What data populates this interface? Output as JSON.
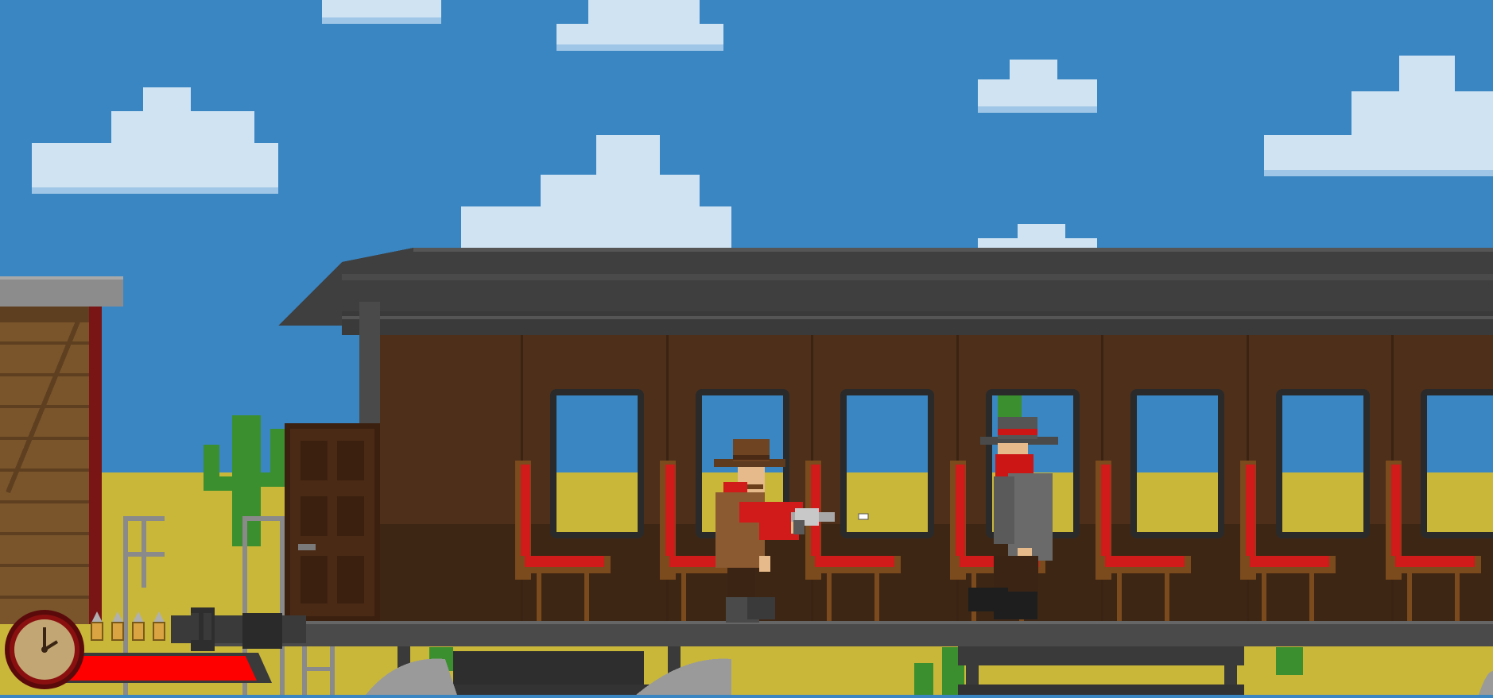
{
  "colors": {
    "sky": "#3a86c2",
    "cloud": "#cfe3f2",
    "cloud_shade": "#9fc6e6",
    "desert": "#c9b73a",
    "cactus": "#3b8f2e",
    "train_roof": "#3f3f3f",
    "train_body": "#4d2f1a",
    "train_body_lower": "#3e2614",
    "seat_red": "#d11a1a",
    "seat_wood": "#7b4a1d",
    "health_red": "#ff0000",
    "bandana_red": "#cc1515"
  },
  "icons": {
    "clock": "clock-icon",
    "bullet": "bullet-icon",
    "cactus": "cactus-icon"
  },
  "hud": {
    "ammo_remaining": 4,
    "health_fraction": 0.95
  },
  "scene": {
    "clouds": 8,
    "windows": 7,
    "seats": 7
  }
}
